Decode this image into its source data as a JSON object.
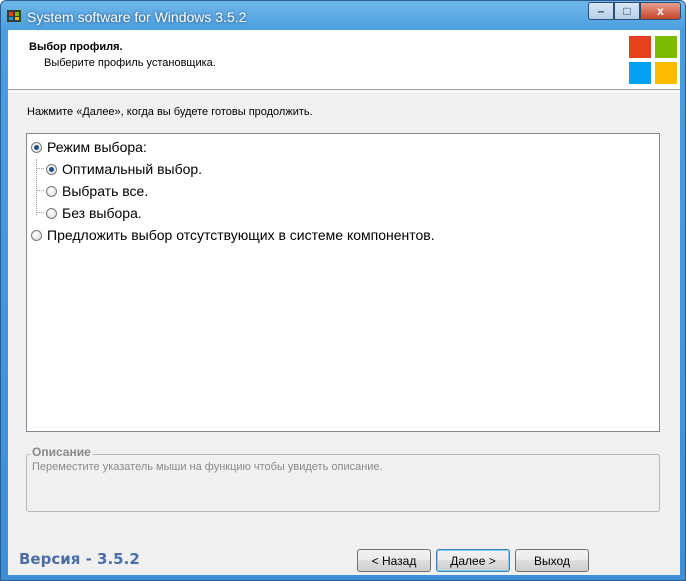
{
  "window": {
    "title": "System software for Windows 3.5.2",
    "controls": {
      "minimize": "–",
      "maximize": "□",
      "close": "x"
    }
  },
  "header": {
    "title": "Выбор профиля.",
    "subtitle": "Выберите профиль установщика.",
    "logo_colors": [
      "#e8401c",
      "#7cbb00",
      "#00a1f1",
      "#ffbb00"
    ]
  },
  "instruction": "Нажмите «Далее», когда вы будете готовы продолжить.",
  "options": [
    {
      "label": "Режим выбора:",
      "selected": true
    },
    {
      "label": "Оптимальный выбор.",
      "selected": true
    },
    {
      "label": "Выбрать все.",
      "selected": false
    },
    {
      "label": "Без выбора.",
      "selected": false
    },
    {
      "label": "Предложить выбор отсутствующих в системе компонентов.",
      "selected": false
    }
  ],
  "description": {
    "legend": "Описание",
    "text": "Переместите указатель мыши на функцию чтобы увидеть описание."
  },
  "footer": {
    "version": "Версия - 3.5.2",
    "back_label": "< Назад",
    "next_label": "Далее >",
    "exit_label": "Выход"
  }
}
